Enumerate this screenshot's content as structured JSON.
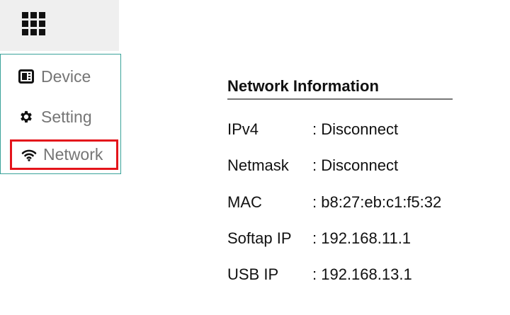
{
  "header": {
    "apps_icon": "grid-icon"
  },
  "sidebar": {
    "items": [
      {
        "label": "Device",
        "icon": "device-icon"
      },
      {
        "label": "Setting",
        "icon": "gear-icon"
      },
      {
        "label": "Network",
        "icon": "wifi-icon",
        "selected": true
      }
    ]
  },
  "network": {
    "title": "Network Information",
    "rows": [
      {
        "label": "IPv4",
        "value": ": Disconnect"
      },
      {
        "label": "Netmask",
        "value": ": Disconnect"
      },
      {
        "label": "MAC",
        "value": ": b8:27:eb:c1:f5:32"
      },
      {
        "label": "Softap IP",
        "value": ": 192.168.11.1"
      },
      {
        "label": "USB IP",
        "value": ": 192.168.13.1"
      }
    ]
  },
  "colors": {
    "header_bg": "#efefef",
    "sidebar_border": "#3aa39a",
    "selected_outline": "#e4141b",
    "menu_text": "#757575"
  }
}
